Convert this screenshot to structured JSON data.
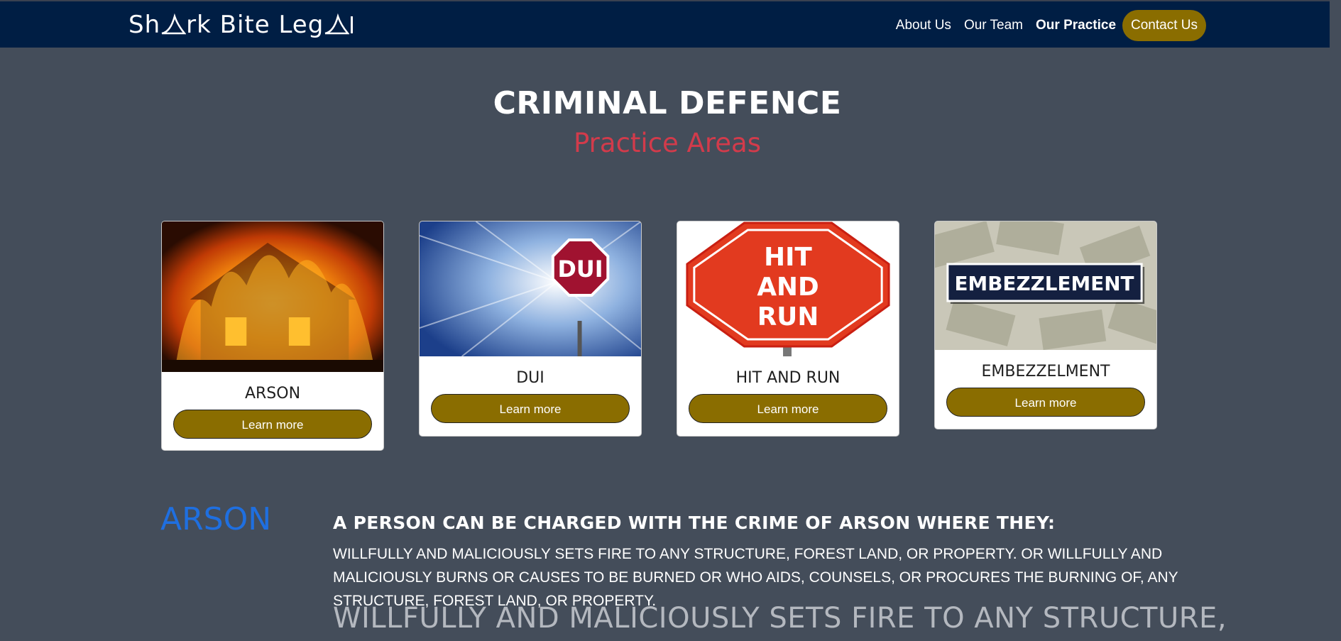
{
  "brand": {
    "name_part1": "Sh",
    "name_part2": "rk Bite Leg",
    "name_end": ""
  },
  "nav": {
    "items": [
      {
        "label": "About Us",
        "active": false
      },
      {
        "label": "Our Team",
        "active": false
      },
      {
        "label": "Our Practice",
        "active": true
      }
    ],
    "contact_label": "Contact Us"
  },
  "hero": {
    "title": "CRIMINAL DEFENCE",
    "subtitle": "Practice Areas"
  },
  "cards": [
    {
      "title": "ARSON",
      "button": "Learn more",
      "image_icon": "burning-house"
    },
    {
      "title": "DUI",
      "button": "Learn more",
      "image_icon": "dui-stop-sign",
      "image_text": "DUI"
    },
    {
      "title": "HIT AND RUN",
      "button": "Learn more",
      "image_icon": "hit-and-run-sign",
      "image_text": "HIT AND RUN"
    },
    {
      "title": "EMBEZZELMENT",
      "button": "Learn more",
      "image_icon": "money-bills",
      "image_text": "EMBEZZLEMENT"
    }
  ],
  "section": {
    "heading": "ARSON",
    "title": "A PERSON CAN BE CHARGED WITH THE CRIME OF ARSON WHERE THEY:",
    "body": "WILLFULLY AND MALICIOUSLY SETS FIRE TO ANY STRUCTURE, FOREST LAND, OR PROPERTY. OR WILLFULLY AND MALICIOUSLY BURNS OR CAUSES TO BE BURNED OR WHO AIDS, COUNSELS, OR PROCURES THE BURNING OF, ANY STRUCTURE, FOREST LAND, OR PROPERTY.",
    "large": "WILLFULLY AND MALICIOUSLY SETS FIRE TO ANY STRUCTURE,"
  },
  "colors": {
    "navbar": "#001e44",
    "page": "#444d5a",
    "accent": "#8a6d00",
    "subtitle": "#d23b4b",
    "heading_blue": "#1f6fe0"
  }
}
